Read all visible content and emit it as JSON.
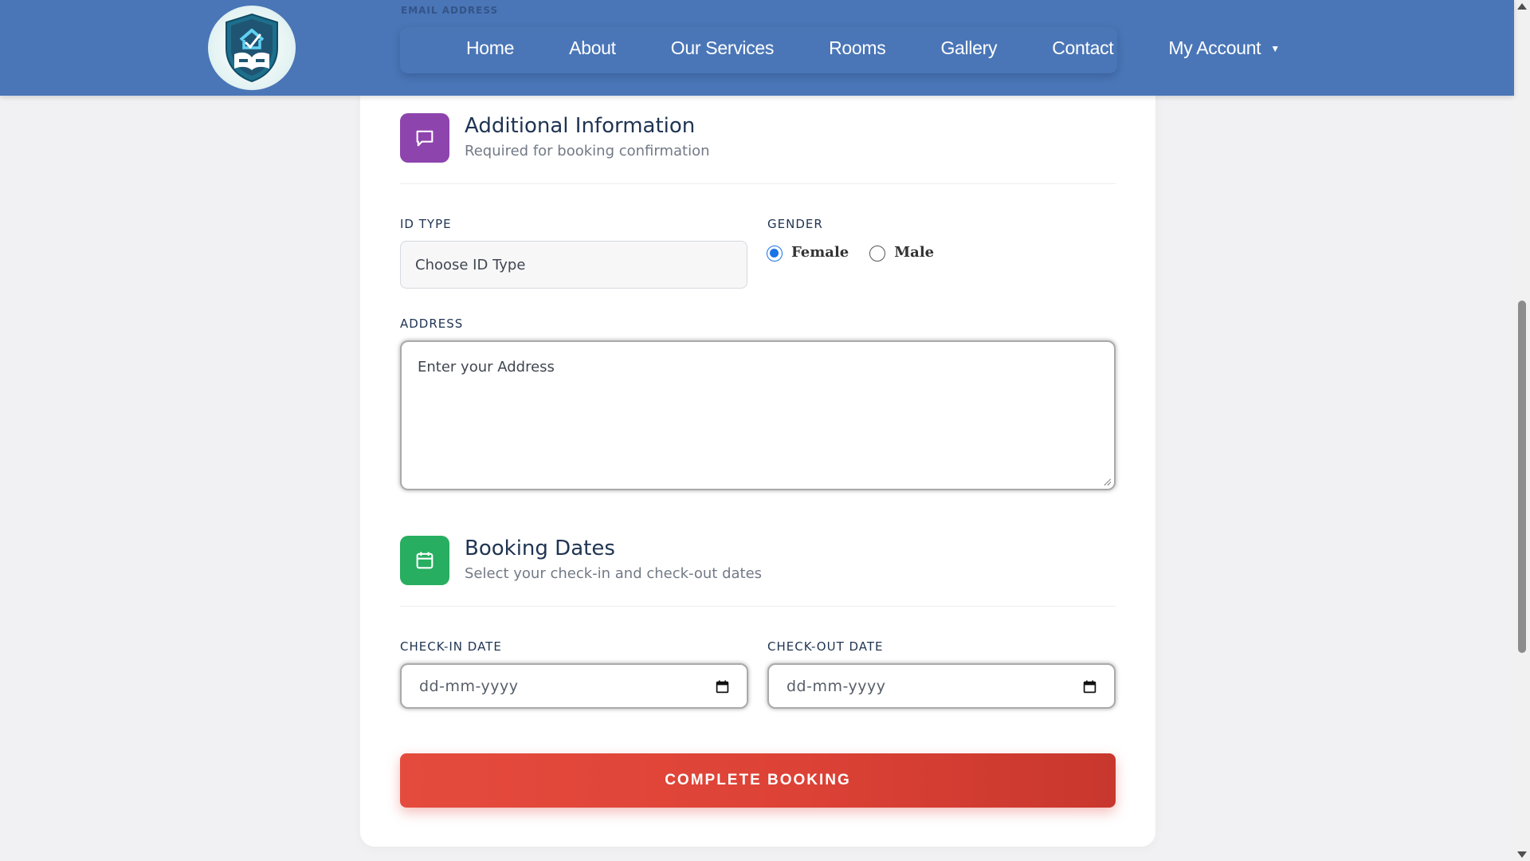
{
  "nav": {
    "items": [
      "Home",
      "About",
      "Our Services",
      "Rooms",
      "Gallery",
      "Contact"
    ],
    "account_label": "My Account",
    "account_caret": "▼",
    "ghost_label": "EMAIL ADDRESS"
  },
  "additional": {
    "title": "Additional Information",
    "subtitle": "Required for booking confirmation",
    "id_type_label": "ID TYPE",
    "id_type_value": "Choose ID Type",
    "gender_label": "GENDER",
    "gender_options": [
      "Female",
      "Male"
    ],
    "gender_selected": "Female",
    "address_label": "ADDRESS",
    "address_placeholder": "Enter your Address"
  },
  "dates": {
    "title": "Booking Dates",
    "subtitle": "Select your check-in and check-out dates",
    "checkin_label": "CHECK-IN DATE",
    "checkout_label": "CHECK-OUT DATE",
    "date_placeholder": "dd-mm-yyyy"
  },
  "submit": {
    "label": "COMPLETE BOOKING"
  },
  "colors": {
    "header": "#4a76b7",
    "info_icon_bg": "#8e44ad",
    "dates_icon_bg": "#27ae60",
    "submit_bg": "#e04438"
  }
}
